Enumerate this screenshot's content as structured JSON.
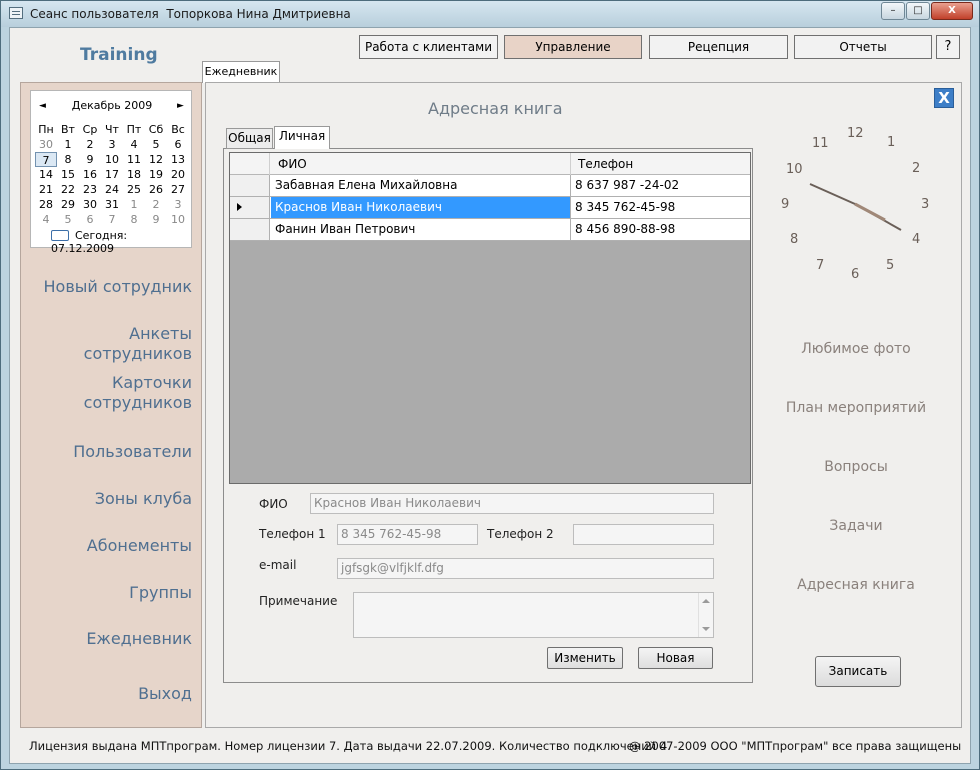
{
  "window": {
    "title": "Сеанс пользователя  Топоркова Нина Дмитриевна",
    "controls": {
      "minimize": "–",
      "maximize": "□",
      "close": "X"
    }
  },
  "brand": "Training",
  "top_nav": [
    "Работа с клиентами",
    "Управление",
    "Рецепция",
    "Отчеты"
  ],
  "help": "?",
  "main_tab": "Ежедневник",
  "calendar": {
    "month": "Декабрь 2009",
    "prev": "◄",
    "next": "►",
    "weekdays": [
      "Пн",
      "Вт",
      "Ср",
      "Чт",
      "Пт",
      "Сб",
      "Вс"
    ],
    "days": [
      [
        "30",
        "1",
        "2",
        "3",
        "4",
        "5",
        "6"
      ],
      [
        "7",
        "8",
        "9",
        "10",
        "11",
        "12",
        "13"
      ],
      [
        "14",
        "15",
        "16",
        "17",
        "18",
        "19",
        "20"
      ],
      [
        "21",
        "22",
        "23",
        "24",
        "25",
        "26",
        "27"
      ],
      [
        "28",
        "29",
        "30",
        "31",
        "1",
        "2",
        "3"
      ],
      [
        "4",
        "5",
        "6",
        "7",
        "8",
        "9",
        "10"
      ]
    ],
    "today_label": "Сегодня: 07.12.2009"
  },
  "sidebar": {
    "items": [
      "Новый сотрудник",
      "Анкеты сотрудников",
      "Карточки\nсотрудников",
      "Пользователи",
      "Зоны клуба",
      "Абонементы",
      "Группы",
      "Ежедневник",
      "Выход"
    ]
  },
  "address_book": {
    "title": "Адресная книга",
    "close": "X",
    "tabs": [
      "Общая",
      "Личная"
    ],
    "columns": [
      "ФИО",
      "Телефон"
    ],
    "rows": [
      {
        "name": "Забавная Елена Михайловна",
        "phone": "8 637 987 -24-02"
      },
      {
        "name": "Краснов Иван Николаевич",
        "phone": "8 345 762-45-98"
      },
      {
        "name": "Фанин Иван Петрович",
        "phone": "8 456 890-88-98"
      }
    ],
    "form": {
      "fio_label": "ФИО",
      "fio_value": "Краснов Иван Николаевич",
      "phone1_label": "Телефон 1",
      "phone1_value": "8 345 762-45-98",
      "phone2_label": "Телефон 2",
      "phone2_value": "",
      "email_label": "e-mail",
      "email_value": "jgfsgk@vlfjklf.dfg",
      "note_label": "Примечание",
      "note_value": ""
    },
    "buttons": {
      "edit": "Изменить",
      "new": "Новая"
    }
  },
  "clock": {
    "numbers": [
      "12",
      "1",
      "2",
      "3",
      "4",
      "5",
      "6",
      "7",
      "8",
      "9",
      "10",
      "11"
    ]
  },
  "right_links": [
    "Любимое фото",
    "План мероприятий",
    "Вопросы",
    "Задачи",
    "Адресная книга"
  ],
  "save_button": "Записать",
  "status": {
    "license": "Лицензия выдана МПТпрограм. Номер лицензии 7. Дата выдачи 22.07.2009. Количество подключений 4.",
    "copyright": "@ 2007-2009  ООО \"МПТпрограм\" все права защищены"
  }
}
